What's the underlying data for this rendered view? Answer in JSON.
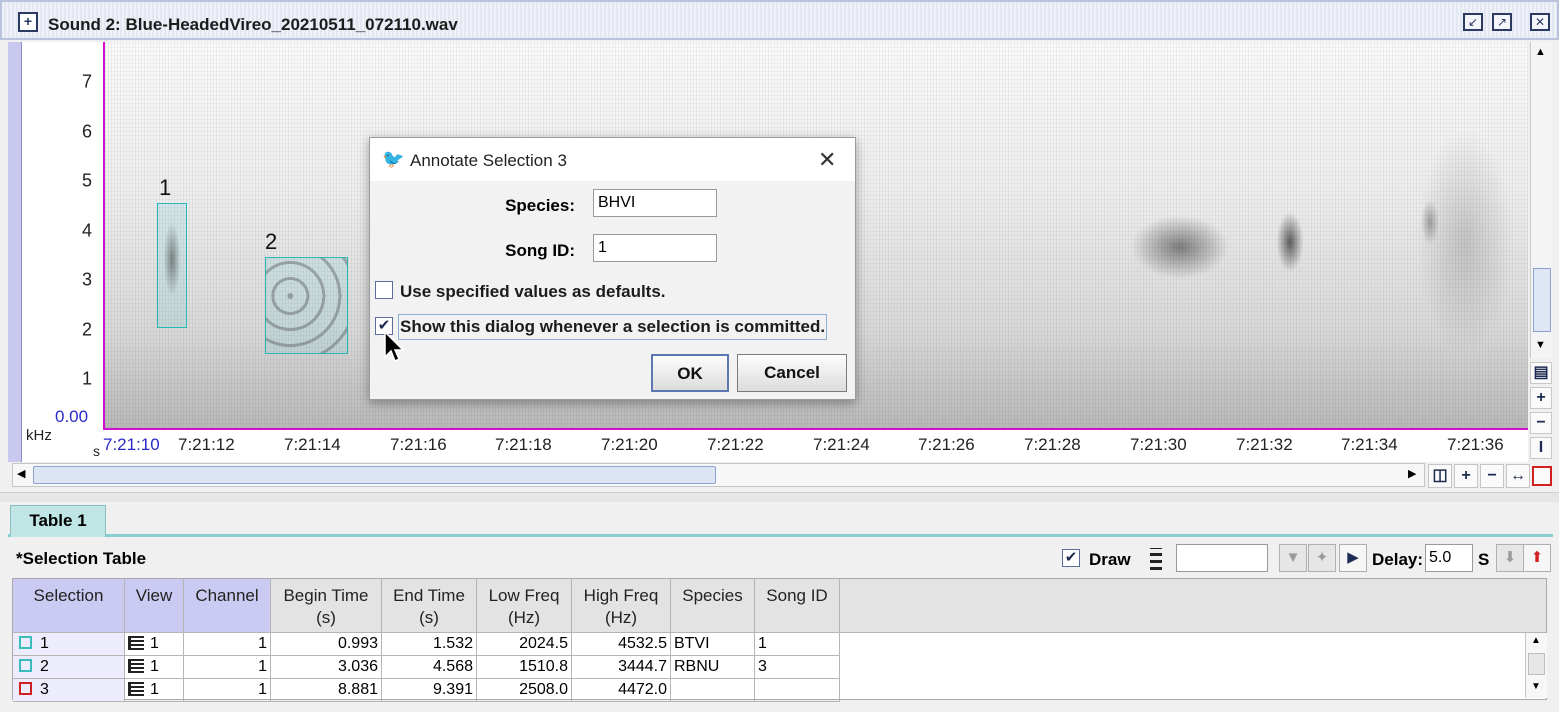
{
  "window": {
    "title": "Sound 2: Blue-HeadedVireo_20210511_072110.wav"
  },
  "spectrogram": {
    "y_ticks": [
      "7",
      "6",
      "5",
      "4",
      "3",
      "2",
      "1"
    ],
    "y_zero": "0.00",
    "y_unit": "kHz",
    "x_unit": "s",
    "x_ticks": [
      "7:21:10",
      "7:21:12",
      "7:21:14",
      "7:21:16",
      "7:21:18",
      "7:21:20",
      "7:21:22",
      "7:21:24",
      "7:21:26",
      "7:21:28",
      "7:21:30",
      "7:21:32",
      "7:21:34",
      "7:21:36"
    ],
    "selection_labels": [
      "1",
      "2"
    ]
  },
  "dialog": {
    "title": "Annotate Selection 3",
    "species_label": "Species:",
    "species_value": "BHVI",
    "song_id_label": "Song ID:",
    "song_id_value": "1",
    "use_defaults_label": "Use specified values as defaults.",
    "use_defaults_checked": false,
    "show_dialog_label": "Show this dialog whenever a selection is committed.",
    "show_dialog_checked": true,
    "ok_label": "OK",
    "cancel_label": "Cancel"
  },
  "table_panel": {
    "tab_label": "Table 1",
    "title": "*Selection Table",
    "draw_label": "Draw",
    "draw_checked": true,
    "delay_label": "Delay:",
    "delay_value": "5.0",
    "delay_unit": "S",
    "columns": [
      {
        "line1": "Selection",
        "line2": ""
      },
      {
        "line1": "View",
        "line2": ""
      },
      {
        "line1": "Channel",
        "line2": ""
      },
      {
        "line1": "Begin Time",
        "line2": "(s)"
      },
      {
        "line1": "End Time",
        "line2": "(s)"
      },
      {
        "line1": "Low Freq",
        "line2": "(Hz)"
      },
      {
        "line1": "High Freq",
        "line2": "(Hz)"
      },
      {
        "line1": "Species",
        "line2": ""
      },
      {
        "line1": "Song ID",
        "line2": ""
      }
    ],
    "rows": [
      {
        "selection": "1",
        "view": "1",
        "channel": "1",
        "begin": "0.993",
        "end": "1.532",
        "low": "2024.5",
        "high": "4532.5",
        "species": "BTVI",
        "song_id": "1",
        "swatch": "#38bcbc"
      },
      {
        "selection": "2",
        "view": "1",
        "channel": "1",
        "begin": "3.036",
        "end": "4.568",
        "low": "1510.8",
        "high": "3444.7",
        "species": "RBNU",
        "song_id": "3",
        "swatch": "#38bcbc"
      },
      {
        "selection": "3",
        "view": "1",
        "channel": "1",
        "begin": "8.881",
        "end": "9.391",
        "low": "2508.0",
        "high": "4472.0",
        "species": "",
        "song_id": "",
        "swatch": "#d02020"
      }
    ]
  }
}
